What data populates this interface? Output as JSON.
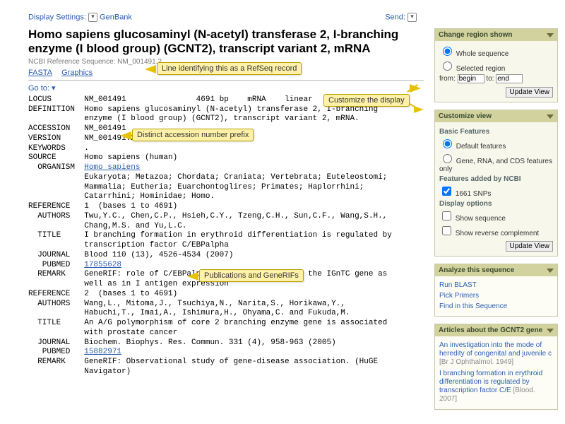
{
  "topbar": {
    "display_settings": "Display Settings:",
    "format": "GenBank",
    "send": "Send:"
  },
  "title": "Homo sapiens glucosaminyl (N-acetyl) transferase 2, I-branching enzyme (I blood group) (GCNT2), transcript variant 2, mRNA",
  "subtitle": "NCBI Reference Sequence: NM_001491.2",
  "tabs": {
    "fasta": "FASTA",
    "graphics": "Graphics"
  },
  "goto": "Go to:",
  "record": {
    "locus": "LOCUS       NM_001491               4691 bp    mRNA    linear   PRI 11-MAR-2011",
    "definition": "DEFINITION  Homo sapiens glucosaminyl (N-acetyl) transferase 2, I-branching\n            enzyme (I blood group) (GCNT2), transcript variant 2, mRNA.",
    "accession": "ACCESSION   NM_001491",
    "version": "VERSION     NM_001491.2  GI:38681962",
    "keywords": "KEYWORDS    .",
    "source": "SOURCE      Homo sapiens (human)",
    "organism_l": "  ORGANISM  ",
    "organism": "Homo sapiens",
    "taxonomy": "            Eukaryota; Metazoa; Chordata; Craniata; Vertebrata; Euteleostomi;\n            Mammalia; Eutheria; Euarchontoglires; Primates; Haplorrhini;\n            Catarrhini; Hominidae; Homo.",
    "ref1_h": "REFERENCE   1  (bases 1 to 4691)",
    "ref1_auth": "  AUTHORS   Twu,Y.C., Chen,C.P., Hsieh,C.Y., Tzeng,C.H., Sun,C.F., Wang,S.H.,\n            Chang,M.S. and Yu,L.C.",
    "ref1_title": "  TITLE     I branching formation in erythroid differentiation is regulated by\n            transcription factor C/EBPalpha",
    "ref1_jrnl": "  JOURNAL   Blood 110 (13), 4526-4534 (2007)",
    "ref1_pm_l": "   PUBMED   ",
    "ref1_pm": "17855628",
    "ref1_rem": "  REMARK    GeneRIF: role of C/EBPalpha in the induction of the IGnTC gene as\n            well as in I antigen expression",
    "ref2_h": "REFERENCE   2  (bases 1 to 4691)",
    "ref2_auth": "  AUTHORS   Wang,L., Mitoma,J., Tsuchiya,N., Narita,S., Horikawa,Y.,\n            Habuchi,T., Imai,A., Ishimura,H., Ohyama,C. and Fukuda,M.",
    "ref2_title": "  TITLE     An A/G polymorphism of core 2 branching enzyme gene is associated\n            with prostate cancer",
    "ref2_jrnl": "  JOURNAL   Biochem. Biophys. Res. Commun. 331 (4), 958-963 (2005)",
    "ref2_pm_l": "   PUBMED   ",
    "ref2_pm": "15882971",
    "ref2_rem": "  REMARK    GeneRIF: Observational study of gene-disease association. (HuGE\n            Navigator)"
  },
  "callouts": {
    "refseq_line": "Line identifying this as a RefSeq record",
    "accession_prefix": "Distinct accession number prefix",
    "customize_display": "Customize the display",
    "pubs_generifs": "Publications and GeneRIFs"
  },
  "panels": {
    "region": {
      "title": "Change region shown",
      "whole": "Whole sequence",
      "selected": "Selected region",
      "from_lbl": "from:",
      "from_val": "begin",
      "to_lbl": "to:",
      "to_val": "end",
      "update": "Update View"
    },
    "custom": {
      "title": "Customize view",
      "basic_hdr": "Basic Features",
      "default": "Default features",
      "gene_rna": "Gene, RNA, and CDS features only",
      "ncbi_hdr": "Features added by NCBI",
      "snps": "1661 SNPs",
      "disp_hdr": "Display options",
      "show_seq": "Show sequence",
      "show_rc": "Show reverse complement",
      "update": "Update View"
    },
    "analyze": {
      "title": "Analyze this sequence",
      "items": [
        "Run BLAST",
        "Pick Primers",
        "Find in this Sequence"
      ]
    },
    "articles": {
      "title": "Articles about the GCNT2 gene",
      "a1": "An investigation into the mode of heredity of congenital and juvenile c",
      "a1_src": "[Br J Ophthalmol. 1949]",
      "a2": "I branching formation in erythroid differentiation is regulated by transcription factor C/E",
      "a2_src": "[Blood. 2007]"
    }
  }
}
